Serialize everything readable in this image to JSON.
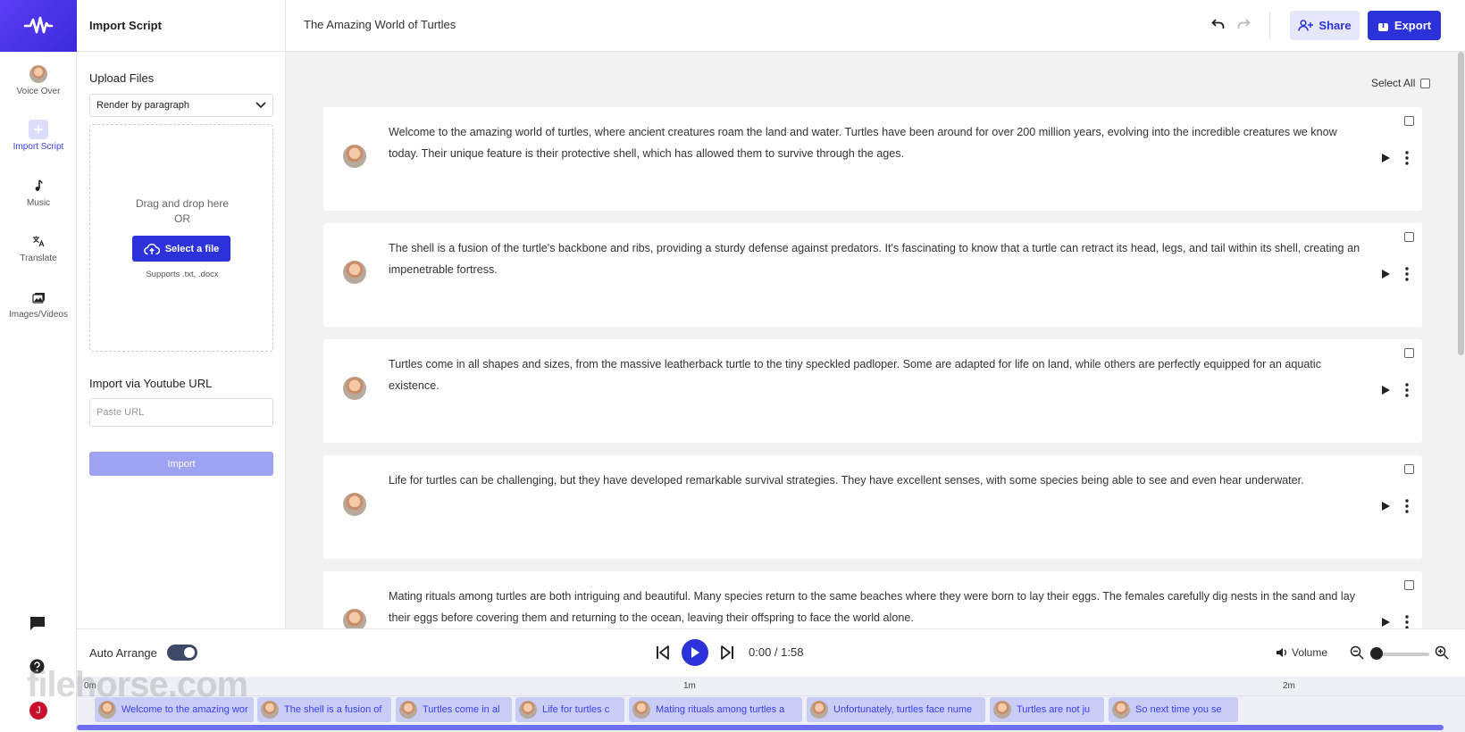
{
  "rail": {
    "items": [
      {
        "label": "Voice Over",
        "icon": "avatar-icon"
      },
      {
        "label": "Import Script",
        "icon": "plus-square-icon"
      },
      {
        "label": "Music",
        "icon": "music-note-icon"
      },
      {
        "label": "Translate",
        "icon": "translate-icon"
      },
      {
        "label": "Images/Videos",
        "icon": "images-icon"
      }
    ],
    "user_initial": "J"
  },
  "panel": {
    "title": "Import Script",
    "upload_label": "Upload Files",
    "render_select": "Render by paragraph",
    "drag_text": "Drag and drop here",
    "or_text": "OR",
    "select_file_label": "Select a file",
    "supports_text": "Supports .txt, .docx",
    "youtube_label": "Import via Youtube URL",
    "url_placeholder": "Paste URL",
    "import_label": "Import"
  },
  "header": {
    "doc_title": "The Amazing World of Turtles",
    "share_label": "Share",
    "export_label": "Export"
  },
  "main": {
    "select_all_label": "Select All",
    "paragraphs": [
      "Welcome to the amazing world of turtles, where ancient creatures roam the land and water. Turtles have been around for over 200 million years, evolving into the incredible creatures we know today. Their unique feature is their protective shell, which has allowed them to survive through the ages.",
      "The shell is a fusion of the turtle's backbone and ribs, providing a sturdy defense against predators. It's fascinating to know that a turtle can retract its head, legs, and tail within its shell, creating an impenetrable fortress.",
      "Turtles come in all shapes and sizes, from the massive leatherback turtle to the tiny speckled padloper. Some are adapted for life on land, while others are perfectly equipped for an aquatic existence.",
      "Life for turtles can be challenging, but they have developed remarkable survival strategies. They have excellent senses, with some species being able to see and even hear underwater.",
      "Mating rituals among turtles are both intriguing and beautiful. Many species return to the same beaches where they were born to lay their eggs. The females carefully dig nests in the sand and lay their eggs before covering them and returning to the ocean, leaving their offspring to face the world alone."
    ]
  },
  "player": {
    "auto_arrange_label": "Auto Arrange",
    "time": "0:00 / 1:58",
    "volume_label": "Volume"
  },
  "timeline": {
    "ticks": [
      "0m",
      "1m",
      "2m"
    ],
    "segments": [
      "Welcome to the amazing wor",
      "The shell is a fusion of",
      "Turtles come in al",
      "Life for turtles c",
      "Mating rituals among turtles a",
      "Unfortunately, turtles face nume",
      "Turtles are not ju",
      "So next time you se"
    ]
  },
  "watermark": "filehorse.com",
  "colors": {
    "accent": "#2b32d9",
    "logo": "#4a33e8",
    "canvas": "#f2f2f2"
  }
}
